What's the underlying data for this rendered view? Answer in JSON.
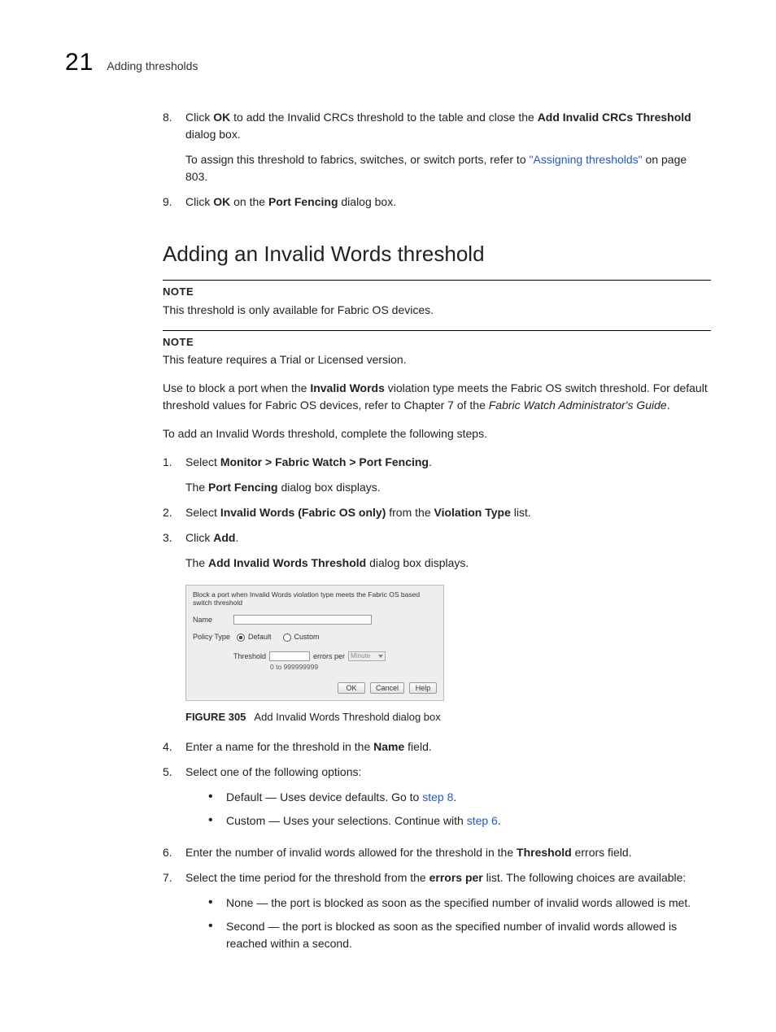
{
  "header": {
    "chapter": "21",
    "title": "Adding thresholds"
  },
  "step8": {
    "num": "8.",
    "l1a": "Click ",
    "l1b": "OK",
    "l1c": " to add the Invalid CRCs threshold to the table and close the ",
    "l1d": "Add Invalid CRCs Threshold",
    "l1e": " dialog box.",
    "l2a": "To assign this threshold to fabrics, switches, or switch ports, refer to ",
    "l2b": "\"Assigning thresholds\"",
    "l2c": " on page 803."
  },
  "step9": {
    "num": "9.",
    "a": "Click ",
    "b": "OK",
    "c": " on the ",
    "d": "Port Fencing",
    "e": " dialog box."
  },
  "section_title": "Adding an Invalid Words threshold",
  "note1": {
    "label": "NOTE",
    "text": "This threshold is only available for Fabric OS devices."
  },
  "note2": {
    "label": "NOTE",
    "text": "This feature requires a Trial or Licensed version."
  },
  "para1": {
    "a": "Use to block a port when the ",
    "b": "Invalid Words",
    "c": " violation type meets the Fabric OS switch threshold. For default threshold values for Fabric OS devices, refer to Chapter 7 of the ",
    "d": "Fabric Watch Administrator's Guide",
    "e": "."
  },
  "para2": "To add an Invalid Words threshold, complete the following steps.",
  "s1": {
    "num": "1.",
    "a": "Select ",
    "b": "Monitor > Fabric Watch > Port Fencing",
    "c": ".",
    "p2a": "The ",
    "p2b": "Port Fencing",
    "p2c": " dialog box displays."
  },
  "s2": {
    "num": "2.",
    "a": "Select ",
    "b": "Invalid Words (Fabric OS only)",
    "c": " from the ",
    "d": "Violation Type",
    "e": " list."
  },
  "s3": {
    "num": "3.",
    "a": "Click ",
    "b": "Add",
    "c": ".",
    "p2a": "The ",
    "p2b": "Add Invalid Words Threshold",
    "p2c": " dialog box displays."
  },
  "dialog": {
    "desc": "Block a port when Invalid Words violation type meets the Fabric OS based switch threshold",
    "name_label": "Name",
    "policy_label": "Policy Type",
    "default": "Default",
    "custom": "Custom",
    "thres_label": "Threshold",
    "errors_per": "errors per",
    "unit": "Minute",
    "range": "0 to 999999999",
    "ok": "OK",
    "cancel": "Cancel",
    "help": "Help"
  },
  "figure": {
    "label": "FIGURE 305",
    "caption": "Add Invalid Words Threshold dialog box"
  },
  "s4": {
    "num": "4.",
    "a": "Enter a name for the threshold in the ",
    "b": "Name",
    "c": " field."
  },
  "s5": {
    "num": "5.",
    "a": "Select one of the following options:",
    "b1a": "Default — Uses device defaults. Go to ",
    "b1b": "step 8",
    "b1c": ".",
    "b2a": "Custom — Uses your selections. Continue with ",
    "b2b": "step 6",
    "b2c": "."
  },
  "s6": {
    "num": "6.",
    "a": "Enter the number of invalid words allowed for the threshold in the ",
    "b": "Threshold",
    "c": " errors field."
  },
  "s7": {
    "num": "7.",
    "a": "Select the time period for the threshold from the ",
    "b": "errors per",
    "c": " list. The following choices are available:",
    "b1": "None — the port is blocked as soon as the specified number of invalid words allowed is met.",
    "b2": "Second — the port is blocked as soon as the specified number of invalid words allowed is reached within a second."
  }
}
